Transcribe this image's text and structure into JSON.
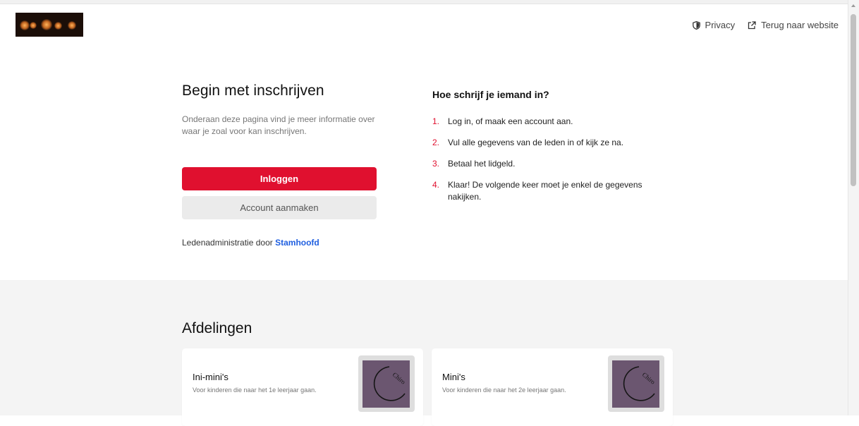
{
  "header": {
    "logo_alt": "",
    "links": [
      {
        "label": "Privacy",
        "icon": "shield-icon"
      },
      {
        "label": "Terug naar website",
        "icon": "external-link-icon"
      }
    ]
  },
  "intro": {
    "title": "Begin met inschrijven",
    "subtitle": "Onderaan deze pagina vind je meer informatie over waar je zoal voor kan inschrijven.",
    "login_label": "Inloggen",
    "signup_label": "Account aanmaken",
    "admin_prefix": "Ledenadministratie door",
    "admin_link": "Stamhoofd"
  },
  "howto": {
    "title": "Hoe schrijf je iemand in?",
    "steps": [
      {
        "num": "1.",
        "text": "Log in, of maak een account aan."
      },
      {
        "num": "2.",
        "text": "Vul alle gegevens van de leden in of kijk ze na."
      },
      {
        "num": "3.",
        "text": "Betaal het lidgeld."
      },
      {
        "num": "4.",
        "text": "Klaar! De volgende keer moet je enkel de gegevens nakijken."
      }
    ]
  },
  "departments": {
    "title": "Afdelingen",
    "items": [
      {
        "name": "Ini-mini's",
        "description": "Voor kinderen die naar het 1e leerjaar gaan.",
        "logo_text": "Chiro"
      },
      {
        "name": "Mini's",
        "description": "Voor kinderen die naar het 2e leerjaar gaan.",
        "logo_text": "Chiro"
      }
    ]
  },
  "colors": {
    "accent": "#e0102f",
    "link": "#1f5fe0",
    "secondary_button": "#ebebeb",
    "section_bg": "#f4f4f4",
    "thumbnail": "#6b5670"
  }
}
